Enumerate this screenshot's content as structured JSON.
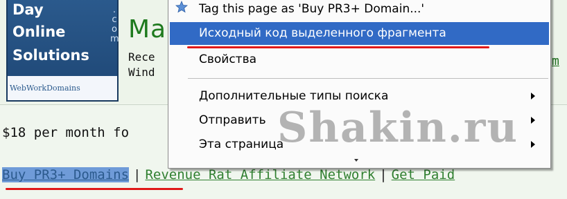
{
  "logo": {
    "line1": "Day",
    "line2": "Online",
    "line3": "Solutions",
    "dotcom": [
      ".",
      "c",
      "o",
      "m"
    ],
    "strip_web": "Web",
    "strip_work": "Work",
    "strip_domains": "Domains"
  },
  "page": {
    "headline": "Ma",
    "desc_line1": "Rece",
    "desc_line2": "Wind",
    "edge_link": "m",
    "price": "$18 per month fo",
    "links": [
      "Buy PR3+ Domains",
      "Revenue Rat Affiliate Network",
      "Get Paid"
    ],
    "link_sep": "|"
  },
  "context_menu": {
    "items": [
      "Tag this page as 'Buy PR3+ Domain...'",
      "Исходный код выделенного фрагмента",
      "Свойства",
      "Дополнительные типы поиска",
      "Отправить",
      "Эта страница"
    ]
  },
  "watermark": "Shakin.ru",
  "colors": {
    "highlight": "#316ac5",
    "red_underline": "#e01818",
    "link_green": "#2f7f2f",
    "logo_blue": "#2b5a8d"
  }
}
